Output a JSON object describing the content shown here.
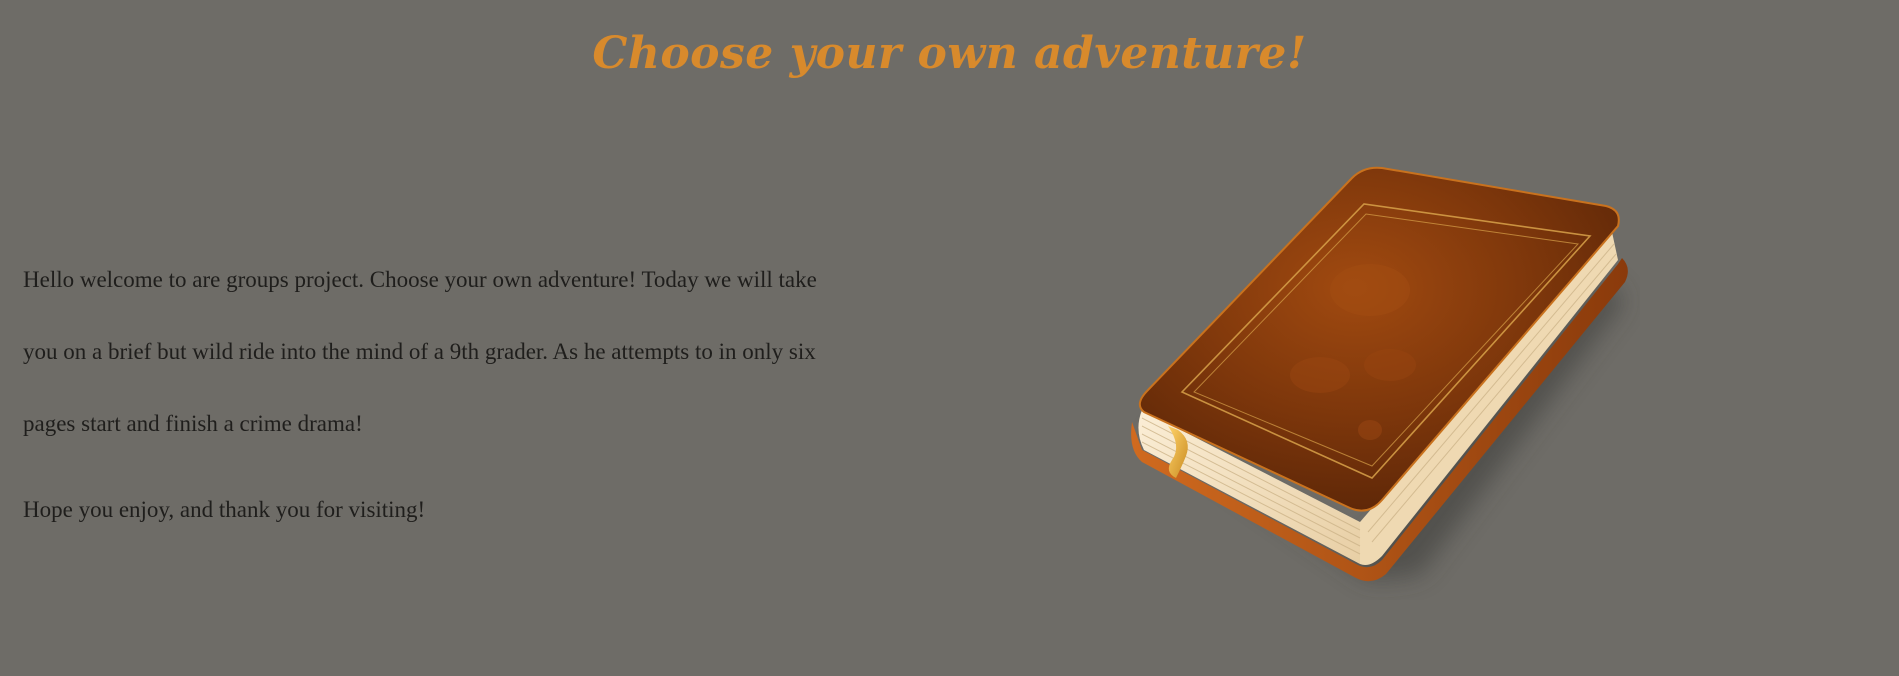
{
  "page": {
    "title": "Choose your own adventure!",
    "intro_text": "Hello welcome to are groups project. Choose your own adventure! Today we will take you on a brief but wild ride into the mind of a 9th grader. As he attempts to in only six pages start and finish a crime drama!",
    "closing_text": "Hope you enjoy, and thank you for visiting!"
  },
  "colors": {
    "background": "#6e6c67",
    "title": "#d88a2c",
    "body_text": "#1f1e1c",
    "book_leather": "#8a3f0c",
    "book_pages": "#f1dfbf"
  },
  "image": {
    "icon": "book-icon"
  }
}
